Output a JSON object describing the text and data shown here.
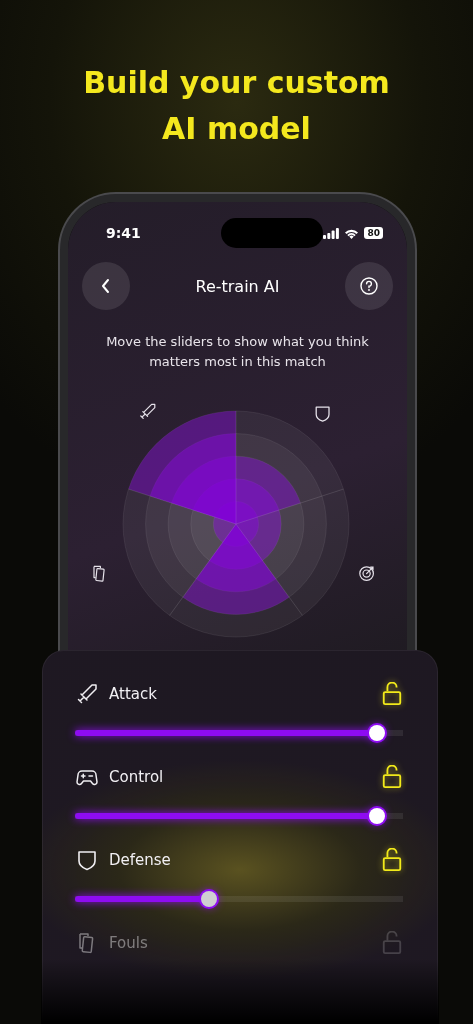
{
  "headline": "Build your custom AI model",
  "status_bar": {
    "time": "9:41",
    "battery": "80"
  },
  "header": {
    "title": "Re-train AI"
  },
  "instructions": "Move the sliders to show what you think matters most in this match",
  "sliders": [
    {
      "label": "Attack",
      "kind": "sword",
      "level": 0.92,
      "locked": false,
      "disabled": false
    },
    {
      "label": "Control",
      "kind": "gamepad",
      "level": 0.92,
      "locked": false,
      "disabled": false
    },
    {
      "label": "Defense",
      "kind": "shield",
      "level": 0.41,
      "locked": false,
      "disabled": false
    },
    {
      "label": "Fouls",
      "kind": "cards",
      "locked": false,
      "disabled": true
    }
  ]
}
